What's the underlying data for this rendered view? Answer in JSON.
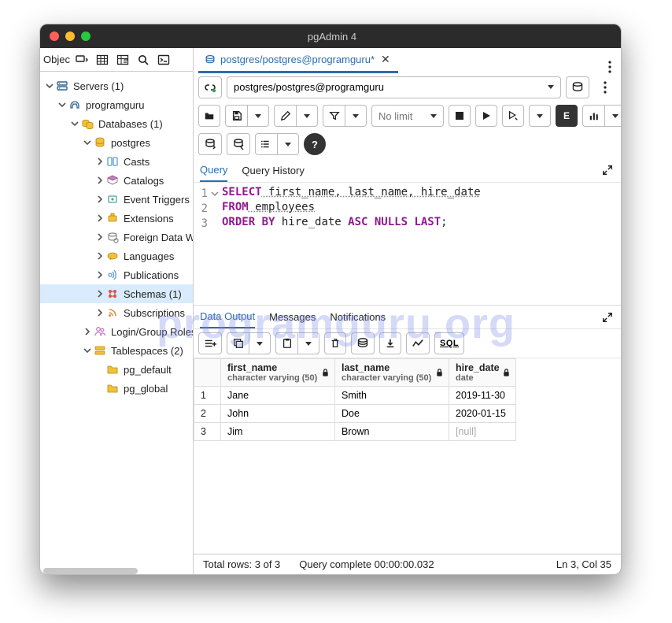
{
  "window_title": "pgAdmin 4",
  "watermark": "programguru.org",
  "sidebar": {
    "label": "Objec",
    "tree": [
      {
        "depth": 0,
        "expand": "down",
        "icon": "server",
        "label": "Servers (1)"
      },
      {
        "depth": 1,
        "expand": "down",
        "icon": "elephant",
        "label": "programguru"
      },
      {
        "depth": 2,
        "expand": "down",
        "icon": "dbcluster",
        "label": "Databases (1)"
      },
      {
        "depth": 3,
        "expand": "down",
        "icon": "db",
        "label": "postgres"
      },
      {
        "depth": 4,
        "expand": "right",
        "icon": "cast",
        "label": "Casts"
      },
      {
        "depth": 4,
        "expand": "right",
        "icon": "catalog",
        "label": "Catalogs"
      },
      {
        "depth": 4,
        "expand": "right",
        "icon": "trigger",
        "label": "Event Triggers"
      },
      {
        "depth": 4,
        "expand": "right",
        "icon": "ext",
        "label": "Extensions"
      },
      {
        "depth": 4,
        "expand": "right",
        "icon": "fdw",
        "label": "Foreign Data W"
      },
      {
        "depth": 4,
        "expand": "right",
        "icon": "lang",
        "label": "Languages"
      },
      {
        "depth": 4,
        "expand": "right",
        "icon": "pub",
        "label": "Publications"
      },
      {
        "depth": 4,
        "expand": "right",
        "icon": "schema",
        "label": "Schemas (1)",
        "selected": true
      },
      {
        "depth": 4,
        "expand": "right",
        "icon": "sub",
        "label": "Subscriptions"
      },
      {
        "depth": 3,
        "expand": "right",
        "icon": "roles",
        "label": "Login/Group Roles"
      },
      {
        "depth": 3,
        "expand": "down",
        "icon": "tablespace",
        "label": "Tablespaces (2)"
      },
      {
        "depth": 4,
        "expand": "none",
        "icon": "folder",
        "label": "pg_default"
      },
      {
        "depth": 4,
        "expand": "none",
        "icon": "folder",
        "label": "pg_global"
      }
    ]
  },
  "tab": {
    "label": "postgres/postgres@programguru*"
  },
  "connection": "postgres/postgres@programguru",
  "nolimit": "No limit",
  "query_tabs": {
    "query": "Query",
    "history": "Query History"
  },
  "sql": {
    "l1": {
      "kw": "SELECT",
      "rest": " first_name, last_name, hire_date"
    },
    "l2": {
      "kw": "FROM",
      "tbl": " employees"
    },
    "l3": {
      "kw": "ORDER BY",
      "mid": " hire_date ",
      "kw2": "ASC NULLS LAST",
      "end": ";"
    }
  },
  "output_tabs": {
    "data": "Data Output",
    "msg": "Messages",
    "notif": "Notifications"
  },
  "sql_btn": "SQL",
  "columns": [
    {
      "name": "first_name",
      "type": "character varying (50)"
    },
    {
      "name": "last_name",
      "type": "character varying (50)"
    },
    {
      "name": "hire_date",
      "type": "date"
    }
  ],
  "rows": [
    {
      "n": "1",
      "c": [
        "Jane",
        "Smith",
        "2019-11-30"
      ]
    },
    {
      "n": "2",
      "c": [
        "John",
        "Doe",
        "2020-01-15"
      ]
    },
    {
      "n": "3",
      "c": [
        "Jim",
        "Brown",
        null
      ]
    }
  ],
  "status": {
    "rows": "Total rows: 3 of 3",
    "time": "Query complete 00:00:00.032",
    "pos": "Ln 3, Col 35"
  }
}
